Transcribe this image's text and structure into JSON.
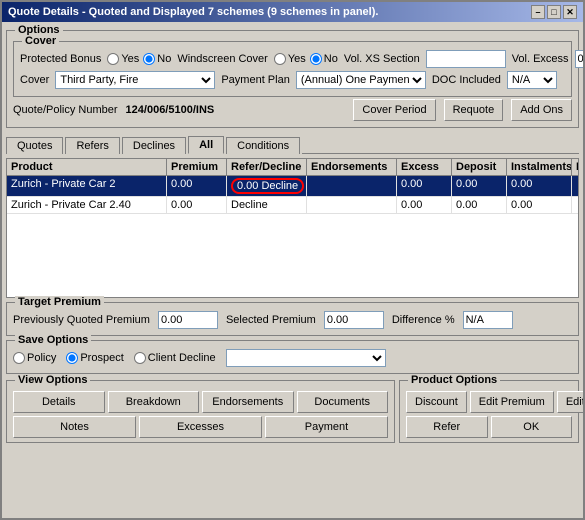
{
  "window": {
    "title": "Quote Details - Quoted and Displayed 7 schemes (9 schemes in panel).",
    "close_btn": "✕",
    "minimize_btn": "–",
    "maximize_btn": "□"
  },
  "options": {
    "label": "Options",
    "cover_group": "Cover",
    "protected_bonus_label": "Protected Bonus",
    "yes_label": "Yes",
    "no_label": "No",
    "windscreen_cover_label": "Windscreen Cover",
    "yes2_label": "Yes",
    "no2_label": "No",
    "vol_xs_section_label": "Vol. XS Section",
    "vol_excess_label": "Vol. Excess",
    "vol_excess_value": "0",
    "cover_label": "Cover",
    "cover_value": "Third Party, Fire",
    "payment_plan_label": "Payment Plan",
    "payment_plan_value": "(Annual) One Payment In",
    "doc_included_label": "DOC Included",
    "doc_value": "N/A",
    "quote_policy_label": "Quote/Policy Number",
    "quote_policy_value": "124/006/5100/INS",
    "cover_period_btn": "Cover Period",
    "requote_btn": "Requote",
    "add_ons_btn": "Add Ons"
  },
  "tabs": [
    {
      "label": "Quotes",
      "active": false
    },
    {
      "label": "Refers",
      "active": false
    },
    {
      "label": "Declines",
      "active": false
    },
    {
      "label": "All",
      "active": true
    },
    {
      "label": "Conditions",
      "active": false
    }
  ],
  "table": {
    "headers": [
      "Product",
      "Premium",
      "Refer/Decline",
      "Endorsements",
      "Excess",
      "Deposit",
      "Instalments",
      "DOC"
    ],
    "rows": [
      {
        "product": "Zurich - Private Car 2",
        "premium": "0.00",
        "refer_decline": "Decline",
        "endorsements": "",
        "excess": "0.00",
        "deposit": "0.00",
        "instalments": "0.00",
        "doc": "",
        "selected": true,
        "decline_circled": true
      },
      {
        "product": "Zurich - Private Car 2.40",
        "premium": "0.00",
        "refer_decline": "Decline",
        "endorsements": "",
        "excess": "0.00",
        "deposit": "0.00",
        "instalments": "0.00",
        "doc": "",
        "selected": false,
        "decline_circled": false
      }
    ]
  },
  "target_premium": {
    "label": "Target Premium",
    "prev_quoted_label": "Previously Quoted Premium",
    "prev_quoted_value": "0.00",
    "selected_premium_label": "Selected Premium",
    "selected_premium_value": "0.00",
    "difference_label": "Difference %",
    "difference_value": "N/A"
  },
  "save_options": {
    "label": "Save Options",
    "policy_label": "Policy",
    "prospect_label": "Prospect",
    "client_decline_label": "Client Decline",
    "dropdown_value": ""
  },
  "view_options": {
    "label": "View Options",
    "buttons": [
      "Details",
      "Breakdown",
      "Endorsements",
      "Documents",
      "Notes",
      "Excesses",
      "Payment"
    ]
  },
  "product_options": {
    "label": "Product Options",
    "buttons": [
      "Discount",
      "Edit Premium",
      "Edit Comm",
      "Refer",
      "OK"
    ]
  }
}
